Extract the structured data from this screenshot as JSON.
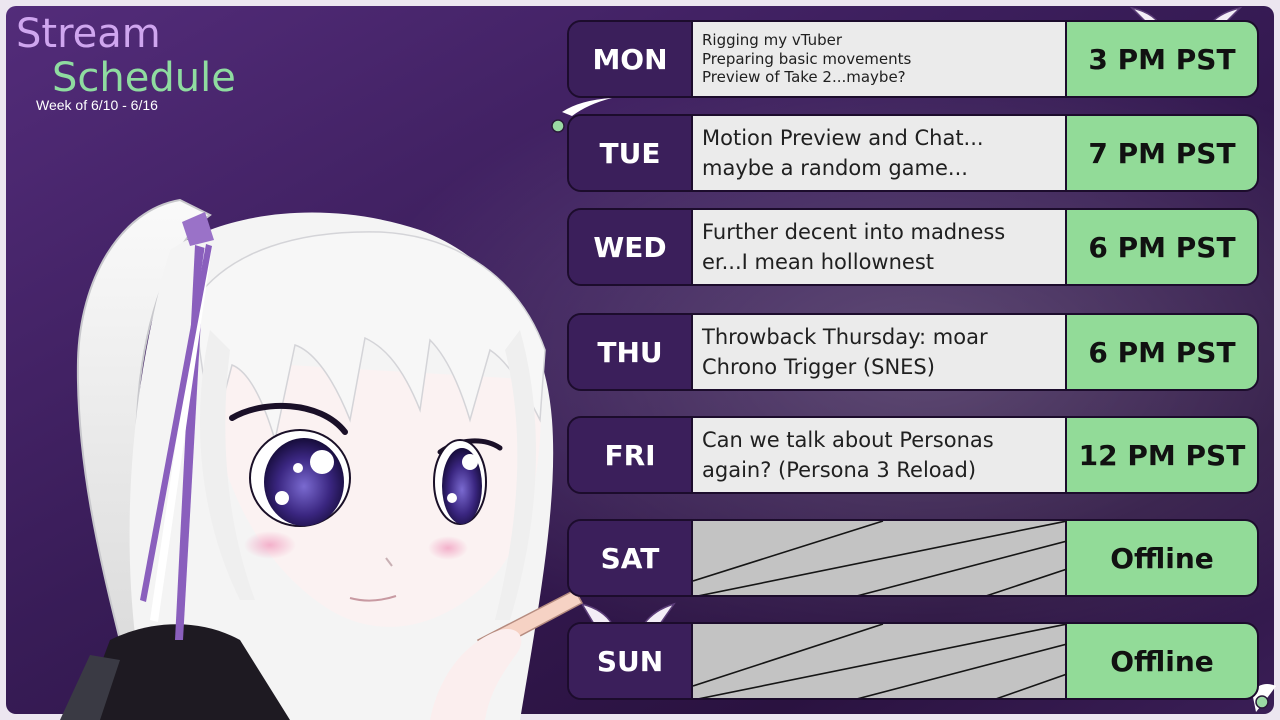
{
  "header": {
    "title_line1": "Stream",
    "title_line2": "Schedule",
    "week": "Week of 6/10 - 6/16"
  },
  "schedule": [
    {
      "day": "MON",
      "lines": [
        "Rigging my vTuber",
        "Preparing basic movements",
        "Preview of Take 2...maybe?"
      ],
      "time": "3 PM PST"
    },
    {
      "day": "TUE",
      "lines": [
        "Motion Preview and Chat...",
        "maybe a random game..."
      ],
      "time": "7 PM PST"
    },
    {
      "day": "WED",
      "lines": [
        "Further decent into madness",
        "er...I mean hollownest"
      ],
      "time": "6 PM PST"
    },
    {
      "day": "THU",
      "lines": [
        "Throwback Thursday: moar",
        "Chrono Trigger (SNES)"
      ],
      "time": "6 PM PST"
    },
    {
      "day": "FRI",
      "lines": [
        "Can we talk about Personas",
        "again? (Persona 3 Reload)"
      ],
      "time": "12 PM PST"
    },
    {
      "day": "SAT",
      "lines": [],
      "time": "Offline"
    },
    {
      "day": "SUN",
      "lines": [],
      "time": "Offline"
    }
  ],
  "colors": {
    "background_dark": "#2e1644",
    "background_light": "#8a6aa8",
    "day_cell": "#3b1f5b",
    "desc_cell": "#ebebeb",
    "time_cell": "#92db98",
    "offline_cell": "#c3c3c3",
    "title_purple": "#cfa6ef",
    "title_green": "#8fdca0"
  }
}
